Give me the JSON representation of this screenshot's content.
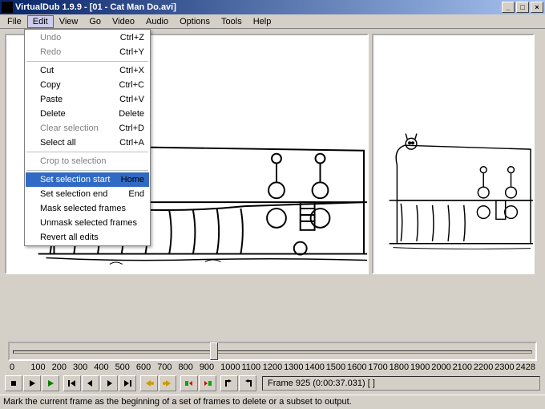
{
  "window": {
    "title": "VirtualDub 1.9.9 - [01 - Cat Man Do.avi]"
  },
  "menubar": [
    "File",
    "Edit",
    "View",
    "Go",
    "Video",
    "Audio",
    "Options",
    "Tools",
    "Help"
  ],
  "edit_menu": {
    "undo": {
      "label": "Undo",
      "sc": "Ctrl+Z",
      "disabled": true
    },
    "redo": {
      "label": "Redo",
      "sc": "Ctrl+Y",
      "disabled": true
    },
    "cut": {
      "label": "Cut",
      "sc": "Ctrl+X"
    },
    "copy": {
      "label": "Copy",
      "sc": "Ctrl+C"
    },
    "paste": {
      "label": "Paste",
      "sc": "Ctrl+V"
    },
    "delete": {
      "label": "Delete",
      "sc": "Delete"
    },
    "clear_selection": {
      "label": "Clear selection",
      "sc": "Ctrl+D",
      "disabled": true
    },
    "select_all": {
      "label": "Select all",
      "sc": "Ctrl+A"
    },
    "crop": {
      "label": "Crop to selection",
      "disabled": true
    },
    "sel_start": {
      "label": "Set selection start",
      "sc": "Home"
    },
    "sel_end": {
      "label": "Set selection end",
      "sc": "End"
    },
    "mask": {
      "label": "Mask selected frames"
    },
    "unmask": {
      "label": "Unmask selected frames"
    },
    "revert": {
      "label": "Revert all edits"
    }
  },
  "timeline": {
    "ticks": [
      "0",
      "100",
      "200",
      "300",
      "400",
      "500",
      "600",
      "700",
      "800",
      "900",
      "1000",
      "1100",
      "1200",
      "1300",
      "1400",
      "1500",
      "1600",
      "1700",
      "1800",
      "1900",
      "2000",
      "2100",
      "2200",
      "2300"
    ],
    "max": "2428",
    "pos_fraction": 0.381
  },
  "frame_info": "Frame 925 (0:00:37.031) [ ]",
  "status": "Mark the current frame as the beginning of a set of frames to delete or a subset to output."
}
